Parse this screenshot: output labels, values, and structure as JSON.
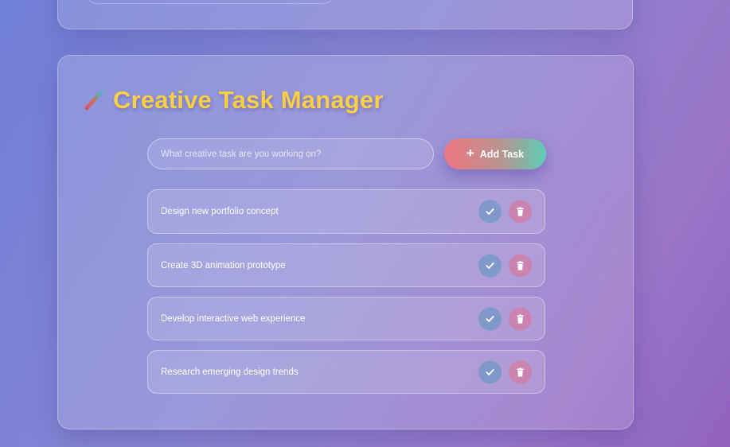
{
  "app": {
    "title": "Creative Task Manager",
    "title_icon": "paintbrush-icon",
    "title_color": "#f8cf45"
  },
  "form": {
    "input_value": "",
    "placeholder": "What creative task are you working on?",
    "add_button_label": "Add Task",
    "add_button_icon": "plus-icon",
    "add_button_gradient": [
      "#ef7683",
      "#5ecdb7"
    ]
  },
  "tasks": [
    {
      "text": "Design new portfolio concept"
    },
    {
      "text": "Create 3D animation prototype"
    },
    {
      "text": "Develop interactive web experience"
    },
    {
      "text": "Research emerging design trends"
    }
  ],
  "actions": {
    "complete_icon": "check-icon",
    "delete_icon": "trash-icon"
  }
}
